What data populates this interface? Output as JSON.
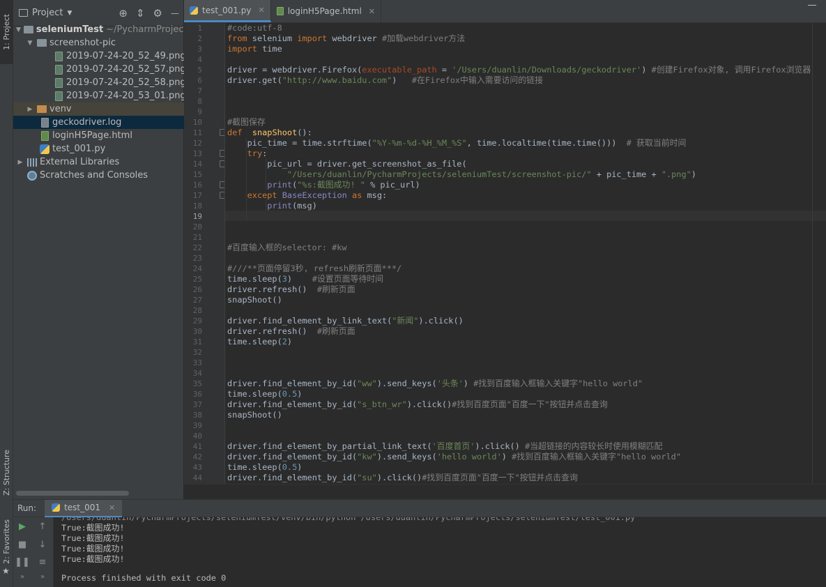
{
  "left_strip": {
    "project_tab": "1: Project",
    "structure_tab": "Z: Structure",
    "favorites_tab": "2: Favorites"
  },
  "project": {
    "title": "Project",
    "tree": [
      {
        "label": "seleniumTest",
        "extra": "~/PycharmProjects",
        "kind": "folder",
        "depth": 0,
        "expanded": true
      },
      {
        "label": "screenshot-pic",
        "kind": "folder",
        "depth": 1,
        "expanded": true
      },
      {
        "label": "2019-07-24-20_52_49.png",
        "kind": "image",
        "depth": 2
      },
      {
        "label": "2019-07-24-20_52_57.png",
        "kind": "image",
        "depth": 2
      },
      {
        "label": "2019-07-24-20_52_58.png",
        "kind": "image",
        "depth": 2
      },
      {
        "label": "2019-07-24-20_53_01.png",
        "kind": "image",
        "depth": 2
      },
      {
        "label": "venv",
        "kind": "folder-orange",
        "depth": 1,
        "expanded": false
      },
      {
        "label": "geckodriver.log",
        "kind": "log",
        "depth": 1
      },
      {
        "label": "loginH5Page.html",
        "kind": "html",
        "depth": 1
      },
      {
        "label": "test_001.py",
        "kind": "python",
        "depth": 1
      },
      {
        "label": "External Libraries",
        "kind": "library",
        "depth": 0,
        "expanded": false
      },
      {
        "label": "Scratches and Consoles",
        "kind": "scratch",
        "depth": 0
      }
    ]
  },
  "editor": {
    "tabs": [
      {
        "label": "test_001.py",
        "active": true
      },
      {
        "label": "loginH5Page.html",
        "active": false
      }
    ],
    "current_line": 19
  },
  "code_lines": [
    "#code:utf-8",
    "from selenium import webdriver #加载webdriver方法",
    "import time",
    "",
    "driver = webdriver.Firefox(executable_path = '/Users/duanlin/Downloads/geckodriver') #创建Firefox对象, 调用Firefox浏览器",
    "driver.get(\"http://www.baidu.com\")   #在Firefox中输入需要访问的链接",
    "",
    "",
    "",
    "#截图保存",
    "def  snapShoot():",
    "    pic_time = time.strftime(\"%Y-%m-%d-%H_%M_%S\", time.localtime(time.time()))  # 获取当前时间",
    "    try:",
    "        pic_url = driver.get_screenshot_as_file(",
    "            \"/Users/duanlin/PycharmProjects/seleniumTest/screenshot-pic/\" + pic_time + \".png\")",
    "        print(\"%s:截图成功! \" % pic_url)",
    "    except BaseException as msg:",
    "        print(msg)",
    "",
    "",
    "",
    "#百度输入框的selector: #kw",
    "",
    "#///**页面停留3秒, refresh刷新页面***/",
    "time.sleep(3)    #设置页面等待时间",
    "driver.refresh()  #刷新页面",
    "snapShoot()",
    "",
    "driver.find_element_by_link_text(\"新闻\").click()",
    "driver.refresh()  #刷新页面",
    "time.sleep(2)",
    "",
    "",
    "",
    "driver.find_element_by_id(\"ww\").send_keys('头条') #找到百度输入框输入关键字\"hello world\"",
    "time.sleep(0.5)",
    "driver.find_element_by_id(\"s_btn_wr\").click()#找到百度页面\"百度一下\"按钮并点击查询",
    "snapShoot()",
    "",
    "",
    "driver.find_element_by_partial_link_text('百度首页').click() #当超链接的内容较长时使用模糊匹配",
    "driver.find_element_by_id(\"kw\").send_keys('hello world') #找到百度输入框输入关键字\"hello world\"",
    "time.sleep(0.5)",
    "driver.find_element_by_id(\"su\").click()#找到百度页面\"百度一下\"按钮并点击查询"
  ],
  "run": {
    "label": "Run:",
    "tab": "test_001",
    "cut_line": "/Users/duanlin/PycharmProjects/seleniumTest/venv/bin/python /Users/duanlin/PycharmProjects/seleniumTest/test_001.py",
    "output": [
      "True:截图成功!",
      "True:截图成功!",
      "True:截图成功!",
      "True:截图成功!",
      "",
      "Process finished with exit code 0"
    ]
  },
  "icons": {
    "project_header": [
      "target-icon",
      "collapse-icon",
      "gear-icon",
      "hide-icon"
    ],
    "run_toolbar": [
      "rerun-icon",
      "stop-icon",
      "pause-icon",
      "more-icon",
      "up-arrow-icon",
      "down-arrow-icon",
      "soft-wrap-icon",
      "more-icon"
    ]
  },
  "colors": {
    "keyword": "#cc7832",
    "string": "#6a8759",
    "comment": "#808080",
    "function": "#ffc66d",
    "number": "#6897bb",
    "param": "#aa4926",
    "background": "#2b2b2b",
    "panel": "#3c3f41"
  }
}
